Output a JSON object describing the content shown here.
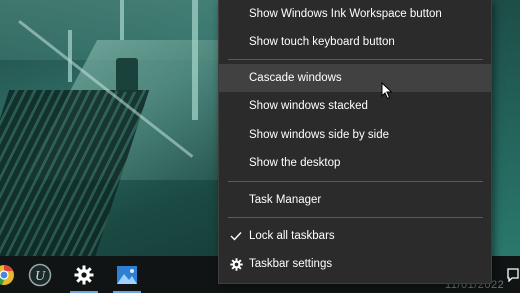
{
  "context_menu": {
    "items": [
      {
        "label": "Show Windows Ink Workspace button"
      },
      {
        "label": "Show touch keyboard button"
      },
      {
        "label": "Cascade windows"
      },
      {
        "label": "Show windows stacked"
      },
      {
        "label": "Show windows side by side"
      },
      {
        "label": "Show the desktop"
      },
      {
        "label": "Task Manager"
      },
      {
        "label": "Lock all taskbars",
        "checked": true
      },
      {
        "label": "Taskbar settings",
        "icon": "gear-icon"
      }
    ],
    "hovered_item": "Cascade windows"
  },
  "taskbar": {
    "pinned": [
      {
        "icon": "chrome-icon"
      },
      {
        "icon": "uplay-icon"
      },
      {
        "icon": "settings-gear-icon",
        "active": true
      },
      {
        "icon": "photos-icon",
        "active": true
      }
    ],
    "clock_text": "11/01/2022"
  },
  "colors": {
    "menu_bg": "#2b2b2b",
    "menu_hover": "#414141",
    "menu_text": "#ffffff",
    "taskbar_bg": "#101414",
    "active_indicator": "#6fa3d8"
  }
}
